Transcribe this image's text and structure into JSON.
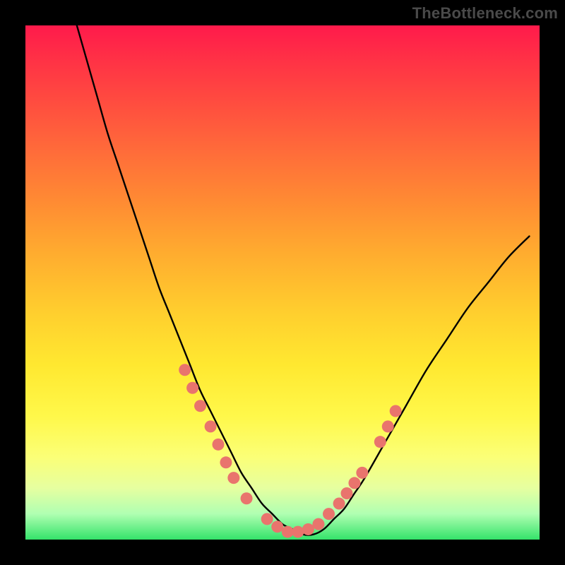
{
  "watermark": "TheBottleneck.com",
  "colors": {
    "frame": "#000000",
    "curve": "#000000",
    "dots": "#e9746d",
    "gradient_stops": [
      "#ff1a4b",
      "#ff2f46",
      "#ff4940",
      "#ff6a3a",
      "#ff8a33",
      "#ffab2f",
      "#ffcf2e",
      "#ffe830",
      "#fff84a",
      "#fbff77",
      "#e6ffa0",
      "#b0ffb2",
      "#34e36a"
    ]
  },
  "chart_data": {
    "type": "line",
    "title": "",
    "xlabel": "",
    "ylabel": "",
    "xlim": [
      0,
      100
    ],
    "ylim": [
      0,
      100
    ],
    "grid": false,
    "legend": false,
    "series": [
      {
        "name": "v-curve",
        "x": [
          10,
          12,
          14,
          16,
          18,
          20,
          22,
          24,
          26,
          28,
          30,
          32,
          34,
          36,
          38,
          40,
          42,
          44,
          46,
          48,
          50,
          52,
          54,
          56,
          58,
          60,
          62,
          64,
          66,
          70,
          74,
          78,
          82,
          86,
          90,
          94,
          98
        ],
        "y": [
          100,
          93,
          86,
          79,
          73,
          67,
          61,
          55,
          49,
          44,
          39,
          34,
          29,
          25,
          21,
          17,
          13,
          10,
          7,
          5,
          3,
          2,
          1,
          1,
          2,
          4,
          6,
          9,
          12,
          19,
          26,
          33,
          39,
          45,
          50,
          55,
          59
        ]
      }
    ],
    "markers": [
      {
        "name": "left-segment-upper",
        "x": [
          31,
          32.5,
          34
        ],
        "y": [
          33,
          29.5,
          26
        ]
      },
      {
        "name": "left-segment-lower",
        "x": [
          36,
          37.5,
          39,
          40.5
        ],
        "y": [
          22,
          18.5,
          15,
          12
        ]
      },
      {
        "name": "left-single",
        "x": [
          43
        ],
        "y": [
          8
        ]
      },
      {
        "name": "bottom-cluster",
        "x": [
          47,
          49,
          51,
          53,
          55,
          57
        ],
        "y": [
          4,
          2.5,
          1.5,
          1.5,
          2,
          3
        ]
      },
      {
        "name": "right-single-low",
        "x": [
          59
        ],
        "y": [
          5
        ]
      },
      {
        "name": "right-segment-lower",
        "x": [
          61,
          62.5,
          64,
          65.5
        ],
        "y": [
          7,
          9,
          11,
          13
        ]
      },
      {
        "name": "right-segment-upper",
        "x": [
          69,
          70.5,
          72
        ],
        "y": [
          19,
          22,
          25
        ]
      }
    ]
  }
}
